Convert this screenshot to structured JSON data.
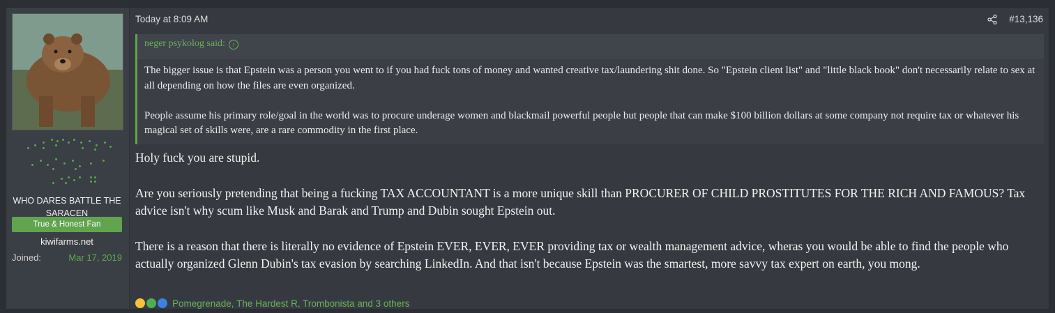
{
  "user": {
    "avatar_alt": "bear",
    "title": "WHO DARES BATTLE THE SARACEN",
    "banner": "True & Honest Fan",
    "site": "kiwifarms.net",
    "joined_label": "Joined:",
    "joined_date": "Mar 17, 2019"
  },
  "post": {
    "date": "Today at 8:09 AM",
    "share_icon": "share-icon",
    "number": "#13,136",
    "quote": {
      "author": "neger psykolog said:",
      "paragraphs": [
        "The bigger issue is that Epstein was a person you went to if you had fuck tons of money and wanted creative tax/laundering shit done. So \"Epstein client list\" and \"little black book\" don't necessarily relate to sex at all depending on how the files are even organized.",
        "People assume his primary role/goal in the world was to procure underage women and blackmail powerful people but people that can make $100 billion dollars at some company not require tax or whatever his magical set of skills were, are a rare commodity in the first place."
      ]
    },
    "body": [
      "Holy fuck you are stupid.",
      "Are you seriously pretending that being a fucking TAX ACCOUNTANT is a more unique skill than PROCURER OF CHILD PROSTITUTES FOR THE RICH AND FAMOUS? Tax advice isn't why scum like Musk and Barak and Trump and Dubin sought Epstein out.",
      "There is a reason that there is literally no evidence of Epstein EVER, EVER, EVER providing tax or wealth management advice, wheras you would be able to find the people who actually organized Glenn Dubin's tax evasion by searching LinkedIn. And that isn't because Epstein was the smartest, more savvy tax expert on earth, you mong."
    ],
    "reactions": {
      "icons": [
        "laughing-face-icon",
        "check-icon",
        "thumbs-up-icon"
      ],
      "text": "Pomegrenade, The Hardest R, Trombonista and 3 others"
    }
  },
  "colors": {
    "accent": "#61a34f",
    "background": "#2b2e33",
    "panel": "#363a40"
  }
}
